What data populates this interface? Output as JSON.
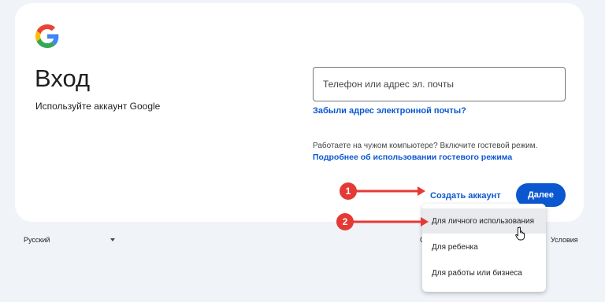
{
  "signin": {
    "title": "Вход",
    "subtitle": "Используйте аккаунт Google",
    "identifier_placeholder": "Телефон или адрес эл. почты",
    "forgot_email": "Забыли адрес электронной почты?",
    "guest_text": "Работаете на чужом компьютере? Включите гостевой режим.",
    "guest_learn_more": "Подробнее об использовании гостевого режима",
    "create_account": "Создать аккаунт",
    "next_button": "Далее"
  },
  "account_menu": {
    "items": [
      {
        "label": "Для личного использования",
        "hovered": true
      },
      {
        "label": "Для ребенка",
        "hovered": false
      },
      {
        "label": "Для работы или бизнеса",
        "hovered": false
      }
    ]
  },
  "footer": {
    "language": "Русский",
    "terms": "Условия",
    "partial_link": "С"
  },
  "annotations": [
    {
      "number": "1"
    },
    {
      "number": "2"
    }
  ],
  "colors": {
    "primary": "#0b57d0",
    "annotation": "#e53935",
    "background": "#f0f4f9"
  },
  "icons": {
    "logo": "google-g-logo",
    "language_caret": "caret-down-icon",
    "cursor": "hand-pointer-icon"
  }
}
